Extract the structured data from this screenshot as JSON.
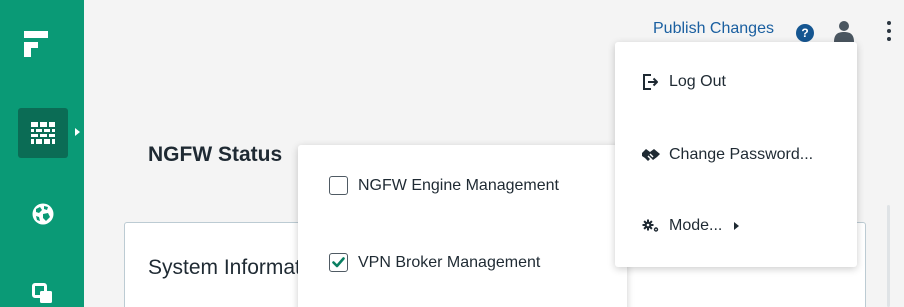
{
  "sidebar": {
    "logo": "forcepoint-logo",
    "items": [
      {
        "icon": "firewall-icon",
        "active": true
      },
      {
        "icon": "globe-icon",
        "active": false
      },
      {
        "icon": "copy-icon",
        "active": false
      }
    ]
  },
  "topbar": {
    "publish_label": "Publish Changes",
    "help_glyph": "?"
  },
  "page": {
    "heading": "NGFW Status",
    "card_title": "System Information"
  },
  "management_menu": {
    "options": [
      {
        "label": "NGFW Engine Management",
        "checked": false
      },
      {
        "label": "VPN Broker Management",
        "checked": true
      }
    ]
  },
  "user_menu": {
    "items": [
      {
        "label": "Log Out",
        "icon": "logout-icon"
      },
      {
        "label": "Change Password...",
        "icon": "handshake-icon"
      },
      {
        "label": "Mode...",
        "icon": "gears-icon",
        "has_submenu": true
      }
    ]
  },
  "colors": {
    "sidebar": "#0a9a76",
    "sidebar_active": "#0b6c55",
    "link": "#1a5fa0",
    "check": "#0a7f62"
  }
}
